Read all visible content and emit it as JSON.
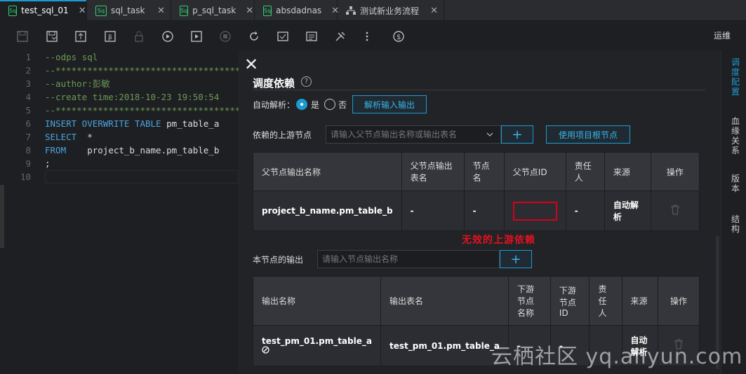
{
  "tabs": [
    {
      "label": "test_sql_01",
      "icon": "sql-file-icon"
    },
    {
      "label": "sql_task",
      "icon": "sql-file-icon"
    },
    {
      "label": "p_sql_task",
      "icon": "sql-file-icon"
    },
    {
      "label": "absdadnas",
      "icon": "sql-file-icon"
    },
    {
      "label": "测试新业务流程",
      "icon": "workflow-icon"
    }
  ],
  "tab_close": "✕",
  "toolbar": {
    "right_label": "运维"
  },
  "editor": {
    "lines": [
      {
        "num": "1",
        "text": "--odps sql"
      },
      {
        "num": "2",
        "text": "--**************************************"
      },
      {
        "num": "3",
        "text": "--author:彭敏"
      },
      {
        "num": "4",
        "text": "--create time:2018-10-23 19:50:54"
      },
      {
        "num": "5",
        "text": "--**************************************"
      },
      {
        "num": "6",
        "kw": "INSERT OVERWRITE TABLE",
        "rest": " pm_table_a"
      },
      {
        "num": "7",
        "kw": "SELECT",
        "rest": "  *"
      },
      {
        "num": "8",
        "kw": "FROM",
        "rest": "    project_b_name.pm_table_b"
      },
      {
        "num": "9",
        "text": ";"
      },
      {
        "num": "10",
        "text": ""
      }
    ]
  },
  "panel": {
    "close": "✕",
    "title": "调度依赖",
    "help": "?",
    "auto_parse_label": "自动解析：",
    "yes": "是",
    "no": "否",
    "parse_io_button": "解析输入输出",
    "upstream_label": "依赖的上游节点",
    "upstream_placeholder": "请输入父节点输出名称或输出表名",
    "add_symbol": "+",
    "root_node_button": "使用项目根节点",
    "upstream_table": {
      "headers": [
        "父节点输出名称",
        "父节点输出表名",
        "节点名",
        "父节点ID",
        "责任人",
        "来源",
        "操作"
      ],
      "row": [
        "project_b_name.pm_table_b",
        "-",
        "-",
        "",
        "-",
        "自动解析"
      ]
    },
    "invalid_note": "无效的上游依赖",
    "output_label": "本节点的输出",
    "output_placeholder": "请输入节点输出名称",
    "output_table": {
      "headers": [
        "输出名称",
        "输出表名",
        "下游节点名称",
        "下游节点ID",
        "责任人",
        "来源",
        "操作"
      ],
      "row": [
        "test_pm_01.pm_table_a",
        "test_pm_01.pm_table_a",
        "-",
        "-",
        "",
        "自动解析"
      ]
    }
  },
  "rail": [
    {
      "label": "调度配置",
      "active": true
    },
    {
      "label": "血缘关系",
      "active": false
    },
    {
      "label": "版本",
      "active": false
    },
    {
      "label": "结构",
      "active": false
    }
  ],
  "watermark": "云栖社区 yq.aliyun.com",
  "colors": {
    "accent": "#1d9bd1",
    "warning": "#e4121f",
    "sql_icon": "#2ecc71"
  }
}
